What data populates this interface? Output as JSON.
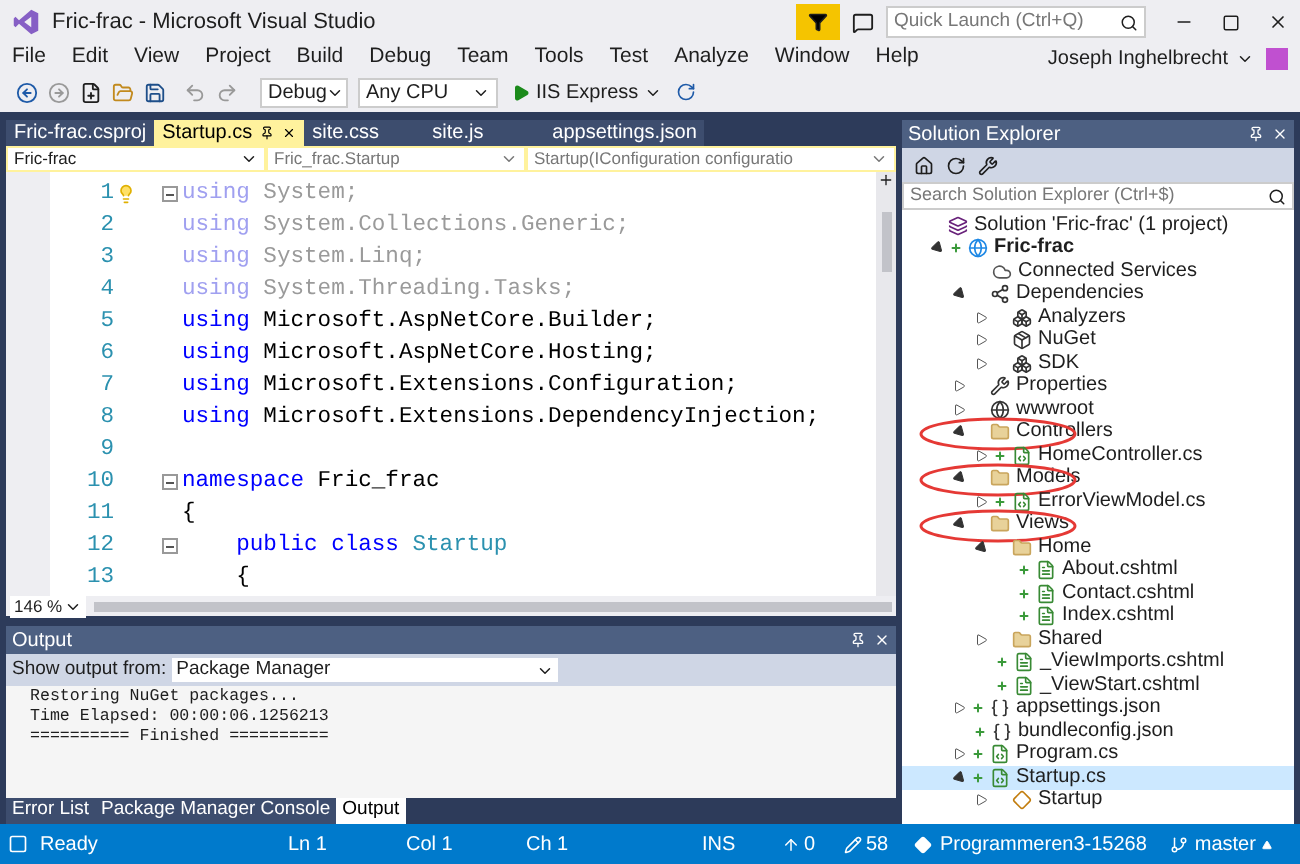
{
  "window": {
    "title": "Fric-frac - Microsoft Visual Studio",
    "quick_launch": {
      "placeholder": "Quick Launch (Ctrl+Q)"
    },
    "user": "Joseph Inghelbrecht"
  },
  "menu": [
    "File",
    "Edit",
    "View",
    "Project",
    "Build",
    "Debug",
    "Team",
    "Tools",
    "Test",
    "Analyze",
    "Window",
    "Help"
  ],
  "toolbar": {
    "configuration": "Debug",
    "platform": "Any CPU",
    "run": "IIS Express"
  },
  "editor": {
    "tabs": [
      {
        "label": "Fric-frac.csproj",
        "selected": false
      },
      {
        "label": "Startup.cs",
        "selected": true
      },
      {
        "label": "site.css",
        "selected": false
      },
      {
        "label": "site.js",
        "selected": false
      },
      {
        "label": "appsettings.json",
        "selected": false
      }
    ],
    "nav": [
      "Fric-frac",
      "Fric_frac.Startup",
      "Startup(IConfiguration configuratio"
    ],
    "lines": [
      {
        "number": "1",
        "fold": true,
        "tokens": [
          {
            "kind": "faded_keyword",
            "text": "using"
          },
          {
            "kind": "faded",
            "text": "System;"
          }
        ]
      },
      {
        "number": "2",
        "fold": false,
        "tokens": [
          {
            "kind": "faded_keyword",
            "text": "using"
          },
          {
            "kind": "faded",
            "text": "System.Collections.Generic;"
          }
        ]
      },
      {
        "number": "3",
        "fold": false,
        "tokens": [
          {
            "kind": "faded_keyword",
            "text": "using"
          },
          {
            "kind": "faded",
            "text": "System.Linq;"
          }
        ]
      },
      {
        "number": "4",
        "fold": false,
        "tokens": [
          {
            "kind": "faded_keyword",
            "text": "using"
          },
          {
            "kind": "faded",
            "text": "System.Threading.Tasks;"
          }
        ]
      },
      {
        "number": "5",
        "fold": false,
        "tokens": [
          {
            "kind": "keyword",
            "text": "using"
          },
          {
            "kind": "plain",
            "text": "Microsoft.AspNetCore.Builder;"
          }
        ]
      },
      {
        "number": "6",
        "fold": false,
        "tokens": [
          {
            "kind": "keyword",
            "text": "using"
          },
          {
            "kind": "plain",
            "text": "Microsoft.AspNetCore.Hosting;"
          }
        ]
      },
      {
        "number": "7",
        "fold": false,
        "tokens": [
          {
            "kind": "keyword",
            "text": "using"
          },
          {
            "kind": "plain",
            "text": "Microsoft.Extensions.Configuration;"
          }
        ]
      },
      {
        "number": "8",
        "fold": false,
        "tokens": [
          {
            "kind": "keyword",
            "text": "using"
          },
          {
            "kind": "plain",
            "text": "Microsoft.Extensions.DependencyInjection;"
          }
        ]
      },
      {
        "number": "9",
        "fold": false
      },
      {
        "number": "10",
        "fold": true,
        "tokens": [
          {
            "kind": "keyword",
            "text": "namespace"
          },
          {
            "kind": "plain",
            "text": "Fric_frac"
          }
        ]
      },
      {
        "number": "11",
        "fold": false,
        "tokens": [
          {
            "kind": "plain",
            "text": "{"
          }
        ]
      },
      {
        "number": "12",
        "fold": true,
        "indented": true,
        "tokens": [
          {
            "kind": "keyword",
            "text": "public class"
          },
          {
            "kind": "type",
            "text": "Startup"
          }
        ]
      },
      {
        "number": "13",
        "fold": false,
        "indented": true,
        "tokens": [
          {
            "kind": "plain",
            "text": "{"
          }
        ]
      }
    ],
    "zoom": "146 %"
  },
  "output": {
    "title": "Output",
    "source_label": "Show output from:",
    "source": "Package Manager",
    "lines": [
      "Restoring NuGet packages...",
      "Time Elapsed: 00:00:06.1256213",
      "========== Finished =========="
    ]
  },
  "bottom_tabs": [
    {
      "label": "Error List",
      "selected": false
    },
    {
      "label": "Package Manager Console",
      "selected": false
    },
    {
      "label": "Output",
      "selected": true
    }
  ],
  "solution_explorer": {
    "title": "Solution Explorer",
    "search": {
      "placeholder": "Search Solution Explorer (Ctrl+$)"
    },
    "tree": [
      {
        "label": "Solution 'Fric-frac' (1 project)",
        "kind": "solution",
        "selected": false,
        "children": [
          {
            "label": "Fric-frac",
            "kind": "project",
            "bold": true,
            "added": true,
            "expanded": true,
            "selected": false,
            "children": [
              {
                "label": "Connected Services",
                "kind": "cloud",
                "selected": false
              },
              {
                "label": "Dependencies",
                "kind": "dependencies",
                "expanded": true,
                "selected": false,
                "children": [
                  {
                    "label": "Analyzers",
                    "kind": "analyzers",
                    "expanded": false,
                    "selected": false
                  },
                  {
                    "label": "NuGet",
                    "kind": "nuget",
                    "expanded": false,
                    "selected": false
                  },
                  {
                    "label": "SDK",
                    "kind": "sdk",
                    "expanded": false,
                    "selected": false
                  }
                ]
              },
              {
                "label": "Properties",
                "kind": "wrench",
                "expanded": false,
                "selected": false
              },
              {
                "label": "wwwroot",
                "kind": "globe",
                "expanded": false,
                "selected": false
              },
              {
                "label": "Controllers",
                "kind": "folder",
                "expanded": true,
                "circled": true,
                "selected": false,
                "children": [
                  {
                    "label": "HomeController.cs",
                    "kind": "cs",
                    "added": true,
                    "expanded": false,
                    "selected": false
                  }
                ]
              },
              {
                "label": "Models",
                "kind": "folder",
                "expanded": true,
                "circled": true,
                "selected": false,
                "children": [
                  {
                    "label": "ErrorViewModel.cs",
                    "kind": "cs",
                    "added": true,
                    "expanded": false,
                    "selected": false
                  }
                ]
              },
              {
                "label": "Views",
                "kind": "folder",
                "expanded": true,
                "circled": true,
                "selected": false,
                "children": [
                  {
                    "label": "Home",
                    "kind": "folder",
                    "expanded": true,
                    "selected": false,
                    "children": [
                      {
                        "label": "About.cshtml",
                        "kind": "cshtml",
                        "added": true,
                        "selected": false
                      },
                      {
                        "label": "Contact.cshtml",
                        "kind": "cshtml",
                        "added": true,
                        "selected": false
                      },
                      {
                        "label": "Index.cshtml",
                        "kind": "cshtml",
                        "added": true,
                        "selected": false
                      }
                    ]
                  },
                  {
                    "label": "Shared",
                    "kind": "folder",
                    "expanded": false,
                    "selected": false
                  },
                  {
                    "label": "_ViewImports.cshtml",
                    "kind": "cshtml",
                    "added": true,
                    "selected": false
                  },
                  {
                    "label": "_ViewStart.cshtml",
                    "kind": "cshtml",
                    "added": true,
                    "selected": false
                  }
                ]
              },
              {
                "label": "appsettings.json",
                "kind": "json",
                "added": true,
                "expanded": false,
                "selected": false
              },
              {
                "label": "bundleconfig.json",
                "kind": "json",
                "added": true,
                "selected": false
              },
              {
                "label": "Program.cs",
                "kind": "cs",
                "added": true,
                "expanded": false,
                "selected": false
              },
              {
                "label": "Startup.cs",
                "kind": "cs",
                "added": true,
                "expanded": true,
                "selected": true,
                "children": [
                  {
                    "label": "Startup",
                    "kind": "class",
                    "expanded": false,
                    "selected": false
                  }
                ]
              }
            ]
          }
        ]
      }
    ]
  },
  "status_bar": {
    "state": "Ready",
    "line": "Ln 1",
    "column": "Col 1",
    "char": "Ch 1",
    "mode": "INS",
    "pending": "0",
    "changes": "58",
    "repository": "Programmeren3-15268",
    "branch": "master"
  }
}
